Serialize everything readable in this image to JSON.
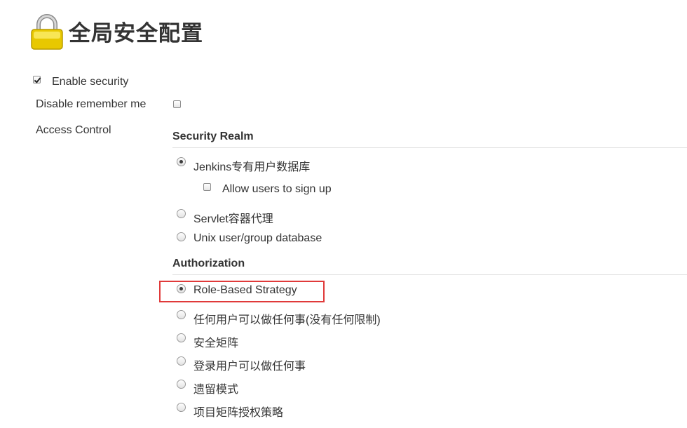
{
  "page": {
    "title": "全局安全配置",
    "icon": "lock-icon"
  },
  "options": {
    "enable_security": {
      "label": "Enable security",
      "checked": true
    },
    "disable_remember_me": {
      "label": "Disable remember me",
      "checked": false
    },
    "access_control_label": "Access Control"
  },
  "security_realm": {
    "heading": "Security Realm",
    "items": [
      {
        "label": "Jenkins专有用户数据库",
        "selected": true
      },
      {
        "label": "Servlet容器代理",
        "selected": false
      },
      {
        "label": "Unix user/group database",
        "selected": false
      }
    ],
    "allow_signup": {
      "label": "Allow users to sign up",
      "checked": false
    }
  },
  "authorization": {
    "heading": "Authorization",
    "items": [
      {
        "label": "Role-Based Strategy",
        "selected": true
      },
      {
        "label": "任何用户可以做任何事(没有任何限制)",
        "selected": false
      },
      {
        "label": "安全矩阵",
        "selected": false
      },
      {
        "label": "登录用户可以做任何事",
        "selected": false
      },
      {
        "label": "遗留模式",
        "selected": false
      },
      {
        "label": "项目矩阵授权策略",
        "selected": false
      }
    ]
  },
  "colors": {
    "highlight_border": "#e03a3a",
    "lock_body": "#f2d400",
    "text": "#333333"
  }
}
